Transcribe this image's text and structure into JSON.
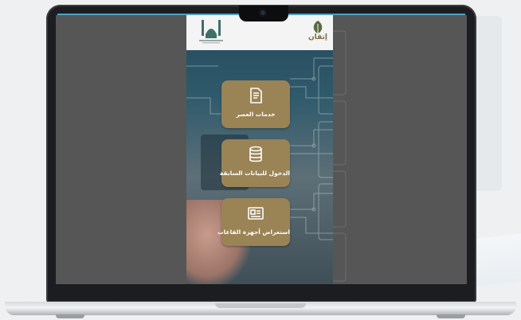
{
  "app": {
    "brand_name": "إتقان",
    "logos": [
      "university-logo",
      "itqan-logo"
    ]
  },
  "menu": {
    "items": [
      {
        "label": "خدمات العصر",
        "icon": "document-icon"
      },
      {
        "label": "الدخول للبيانات السابقة",
        "icon": "database-icon"
      },
      {
        "label": "استعراض أجهزة القاعات",
        "icon": "newspaper-icon"
      }
    ]
  },
  "colors": {
    "tile": "#9a8355",
    "tile_text": "#ffffff",
    "accent": "#4aa3c6",
    "header_bg": "#f3f4f3",
    "screen_bg": "#565656"
  }
}
